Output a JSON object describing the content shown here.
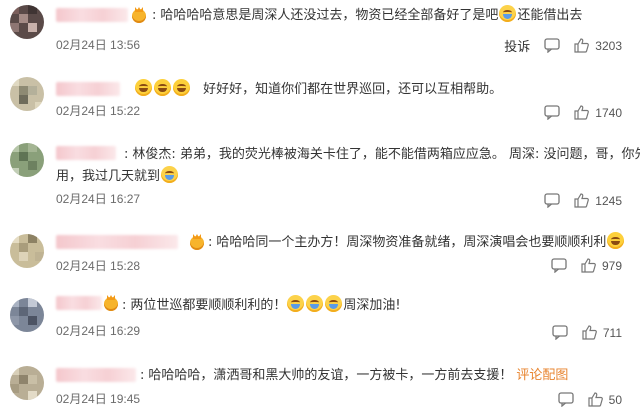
{
  "comments": [
    {
      "text": "哈哈哈哈意思是周深人还没过去，物资已经全部备好了是吧",
      "text_tail": "还能借出去",
      "time": "02月24日 13:56",
      "report": "投诉",
      "likes": "3203"
    },
    {
      "text": "好好好，知道你们都在世界巡回，还可以互相帮助。",
      "time": "02月24日 15:22",
      "likes": "1740"
    },
    {
      "text_line1": "林俊杰: 弟弟，我的荧光棒被海关卡住了，能不能借两箱应应急。 周深: 没问题，哥，你先",
      "text_line2": "用，我过几天就到",
      "time": "02月24日 16:27",
      "likes": "1245"
    },
    {
      "text": "哈哈哈同一个主办方！周深物资准备就绪，周深演唱会也要顺顺利利",
      "time": "02月24日 15:28",
      "likes": "979"
    },
    {
      "text": "两位世巡都要顺顺利利的！",
      "text_tail": "周深加油!",
      "time": "02月24日 16:29",
      "likes": "711"
    },
    {
      "text": "哈哈哈哈，潇洒哥和黑大帅的友谊，一方被卡，一方前去支援！",
      "pic_link": "评论配图",
      "time": "02月24日 19:45",
      "likes": "50"
    }
  ],
  "colors": {
    "text": "#333333",
    "meta": "#6b6b6b",
    "link": "#e8842f",
    "name_blur": "#f6d0d4"
  },
  "icons": [
    "crown-badge-icon",
    "laugh-emoji-icon",
    "cry-emoji-icon",
    "reply-icon",
    "like-icon"
  ]
}
